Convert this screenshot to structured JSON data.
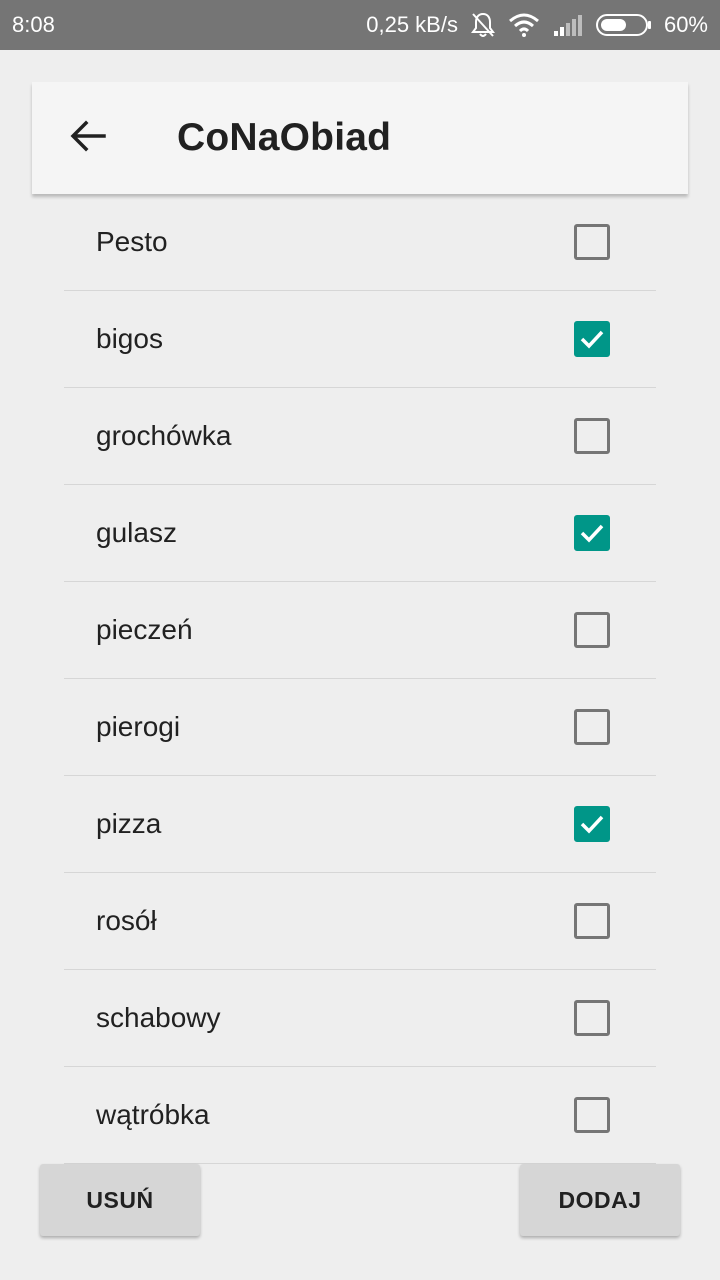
{
  "status_bar": {
    "time": "8:08",
    "network_speed": "0,25 kB/s",
    "battery_percent": "60%",
    "battery_level": 0.6,
    "icons": [
      "bell-off-icon",
      "wifi-icon",
      "cell-signal-icon",
      "battery-icon"
    ]
  },
  "app_bar": {
    "title": "CoNaObiad",
    "back_icon": "arrow-back-icon"
  },
  "list": {
    "items": [
      {
        "label": "Pesto",
        "checked": false
      },
      {
        "label": "bigos",
        "checked": true
      },
      {
        "label": "grochówka",
        "checked": false
      },
      {
        "label": "gulasz",
        "checked": true
      },
      {
        "label": "pieczeń",
        "checked": false
      },
      {
        "label": "pierogi",
        "checked": false
      },
      {
        "label": "pizza",
        "checked": true
      },
      {
        "label": "rosół",
        "checked": false
      },
      {
        "label": "schabowy",
        "checked": false
      },
      {
        "label": "wątróbka",
        "checked": false
      }
    ]
  },
  "buttons": {
    "remove_label": "USUŃ",
    "add_label": "DODAJ"
  },
  "colors": {
    "accent": "#009688",
    "status_bar": "#757575",
    "background": "#eeeeee"
  }
}
